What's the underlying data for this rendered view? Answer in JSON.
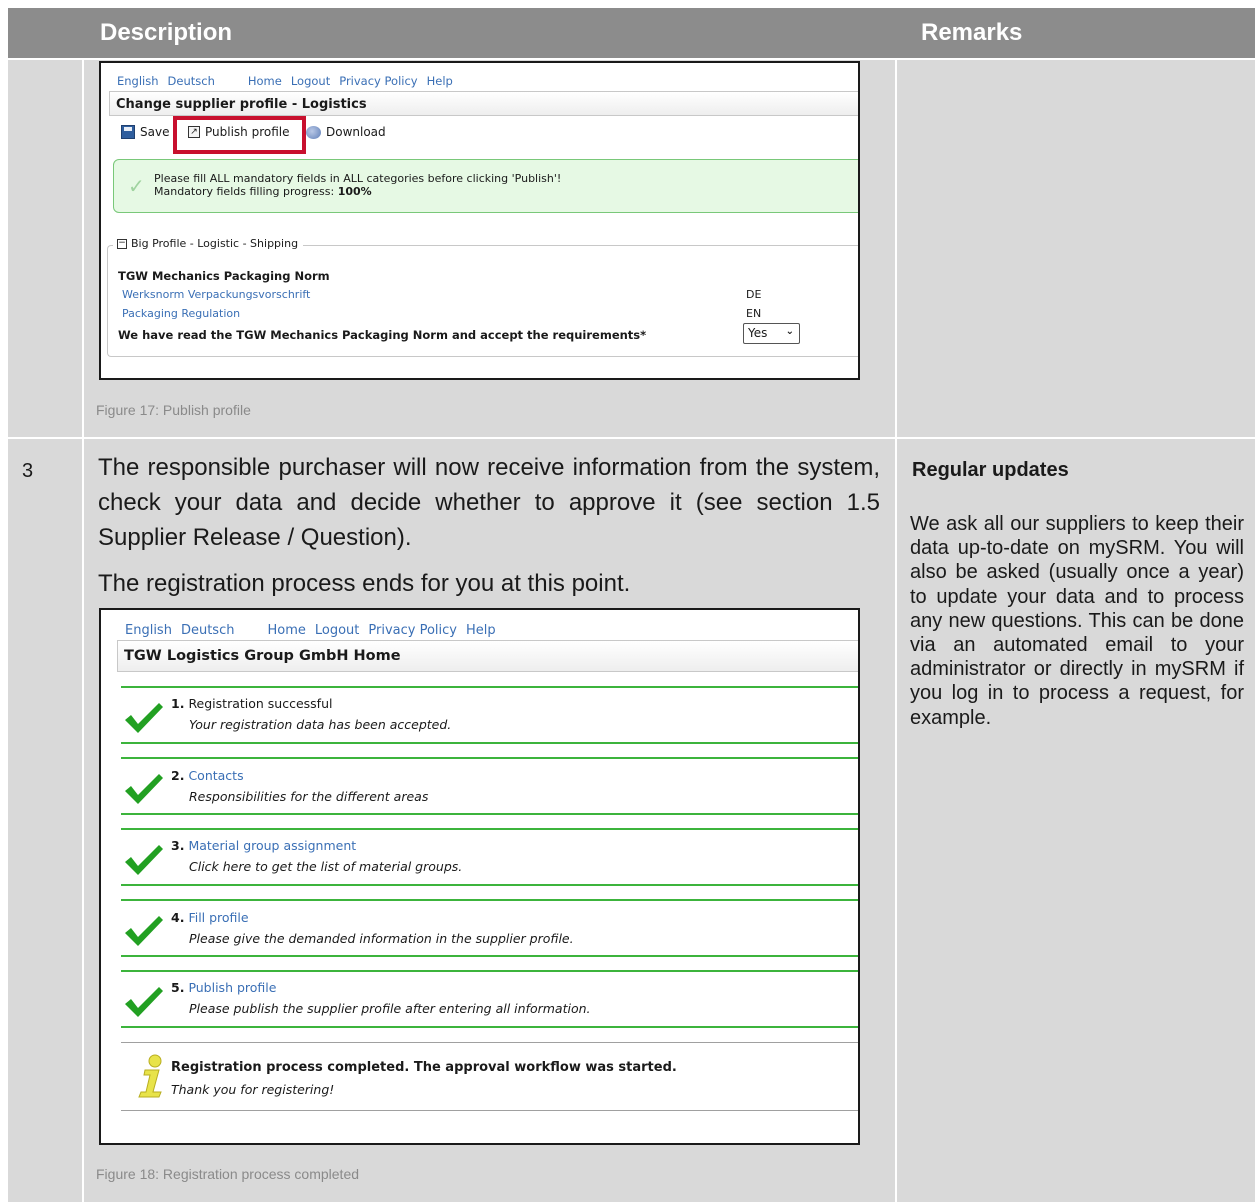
{
  "table": {
    "header_description": "Description",
    "header_remarks": "Remarks",
    "row_number": "3"
  },
  "figure17": {
    "links": [
      "English",
      "Deutsch",
      "Home",
      "Logout",
      "Privacy Policy",
      "Help"
    ],
    "title": "Change supplier profile - Logistics",
    "toolbar": {
      "save": "Save",
      "publish": "Publish profile",
      "download": "Download"
    },
    "message_line1": "Please fill ALL mandatory fields in ALL categories before clicking 'Publish'!",
    "message_line2_label": "Mandatory fields filling progress: ",
    "message_line2_value": "100%",
    "section_legend": "Big Profile - Logistic - Shipping",
    "norm_heading": "TGW Mechanics Packaging Norm",
    "doc1_label": "Werksnorm Verpackungsvorschrift",
    "doc1_lang": "DE",
    "doc2_label": "Packaging Regulation",
    "doc2_lang": "EN",
    "accept_label": "We have read the TGW Mechanics Packaging Norm and accept the requirements*",
    "accept_value": "Yes",
    "caption": "Figure 17: Publish profile"
  },
  "step3": {
    "paragraph1": "The responsible purchaser will now receive information from the system, check your data and decide whether to approve it (see section 1.5 Supplier Release / Question).",
    "paragraph2": "The registration process ends for you at this point."
  },
  "figure18": {
    "links": [
      "English",
      "Deutsch",
      "Home",
      "Logout",
      "Privacy Policy",
      "Help"
    ],
    "title": "TGW Logistics Group GmbH Home",
    "steps": [
      {
        "num": "1.",
        "title": "Registration successful",
        "sub": "Your registration data has been accepted."
      },
      {
        "num": "2.",
        "title": "Contacts",
        "sub": "Responsibilities for the different areas"
      },
      {
        "num": "3.",
        "title": "Material group assignment",
        "sub": "Click here to get the list of material groups."
      },
      {
        "num": "4.",
        "title": "Fill profile",
        "sub": "Please give the demanded information in the supplier profile."
      },
      {
        "num": "5.",
        "title": "Publish profile",
        "sub": "Please publish the supplier profile after entering all information."
      }
    ],
    "completed_title": "Registration process completed. The approval workflow was started.",
    "completed_sub": "Thank you for registering!",
    "caption": "Figure 18: Registration process completed"
  },
  "remarks": {
    "title": "Regular updates",
    "body": "We ask all our suppliers to keep their data up-to-date on mySRM. You will also be asked (usually once a year) to update your data and to process any new questions. This can be done via an automated email to your administrator or directly in mySRM if you log in to process a request, for example."
  },
  "colors": {
    "header_bg": "#8c8c8c",
    "cell_bg": "#d9d9d9",
    "link_blue": "#3a6fb5",
    "highlight_red": "#c8102e",
    "success_green": "#3cb43c"
  }
}
